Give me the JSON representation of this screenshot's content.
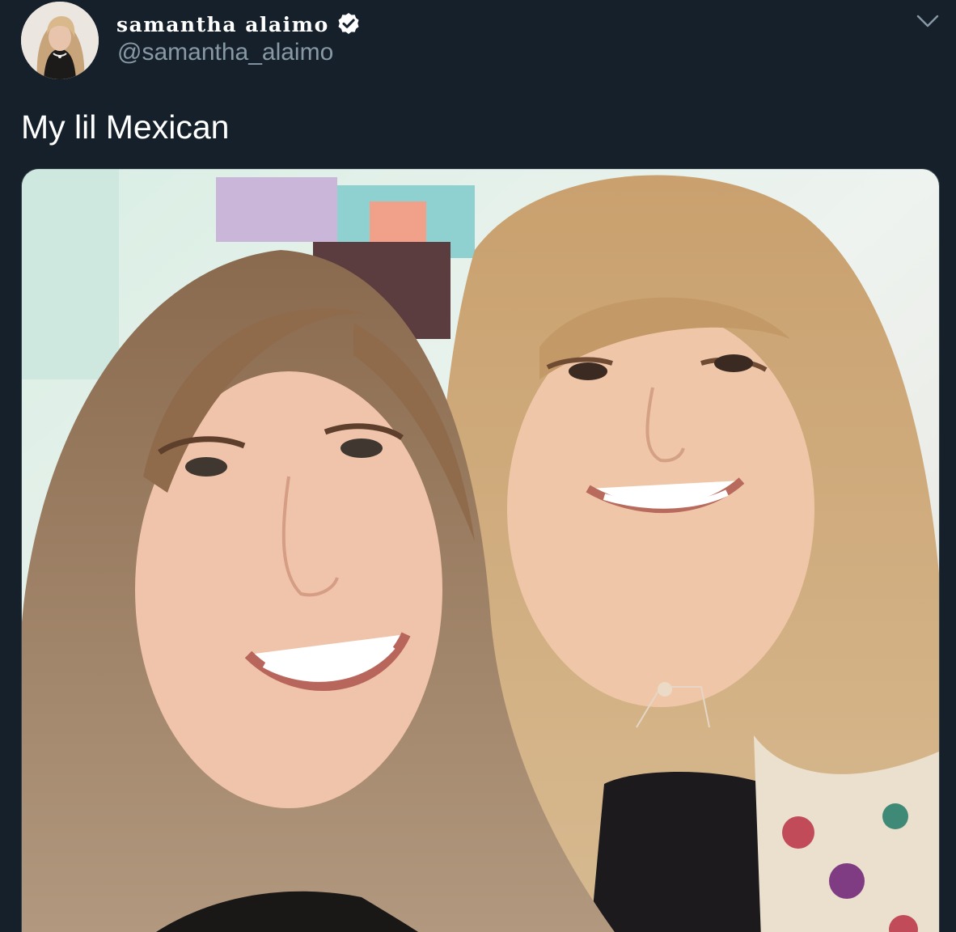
{
  "tweet": {
    "author": {
      "display_name": "samantha alaimo",
      "handle": "@samantha_alaimo",
      "verified": true,
      "verified_icon": "verified-badge-icon"
    },
    "menu_icon": "chevron-down-icon",
    "text": "My lil Mexican",
    "media": {
      "kind": "photo"
    }
  },
  "colors": {
    "background": "#15202b",
    "secondary_text": "#8899a6",
    "border": "#38444d",
    "primary_text": "#ffffff"
  }
}
